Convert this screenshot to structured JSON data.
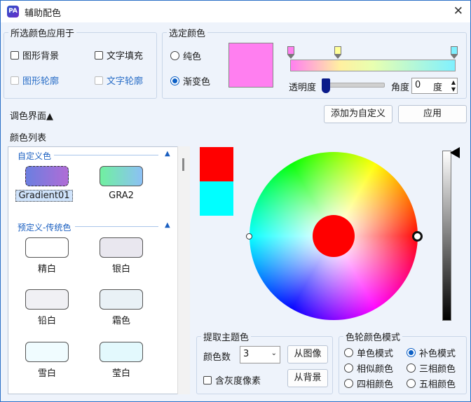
{
  "window": {
    "title": "辅助配色",
    "icon": "app-logo-icon",
    "close_label": "✕"
  },
  "apply_group": {
    "label": "所选颜色应用于",
    "items": [
      {
        "label": "图形背景",
        "checked": false,
        "enabled": true
      },
      {
        "label": "文字填充",
        "checked": false,
        "enabled": true
      },
      {
        "label": "图形轮廓",
        "checked": false,
        "enabled": false
      },
      {
        "label": "文字轮廓",
        "checked": false,
        "enabled": false
      }
    ]
  },
  "selected_color": {
    "label": "选定颜色",
    "solid_label": "纯色",
    "gradient_label": "渐变色",
    "mode": "gradient",
    "preview_color": "#ff7ff0",
    "gradient_stops": [
      {
        "color": "#ff80f0"
      },
      {
        "color": "#ffff99"
      },
      {
        "color": "#80f0ff"
      }
    ],
    "transparency_label": "透明度",
    "transparency": 0,
    "angle_label": "角度",
    "angle_value": "0",
    "angle_unit": "度"
  },
  "toolbar": {
    "palette_toggle": "调色界面▲",
    "add_custom": "添加为自定义",
    "apply": "应用"
  },
  "color_list": {
    "label": "颜色列表",
    "custom_section": "自定义色",
    "custom": [
      {
        "name": "Gradient01",
        "selected": true
      },
      {
        "name": "GRA2",
        "selected": false
      }
    ],
    "preset_section": "预定义-传统色",
    "preset": [
      {
        "name": "精白",
        "color": "#ffffff"
      },
      {
        "name": "银白",
        "color": "#e9e7ef"
      },
      {
        "name": "铅白",
        "color": "#f0f0f4"
      },
      {
        "name": "霜色",
        "color": "#e9f1f6"
      },
      {
        "name": "雪白",
        "color": "#f0fcff"
      },
      {
        "name": "莹白",
        "color": "#e3f9fd"
      }
    ]
  },
  "wheel": {
    "primary": "#ff0000",
    "complement": "#00ffff"
  },
  "extract": {
    "label": "提取主题色",
    "count_label": "颜色数",
    "count_value": "3",
    "from_image": "从图像",
    "gray_label": "含灰度像素",
    "from_background": "从背景"
  },
  "wheel_mode": {
    "label": "色轮颜色模式",
    "options": [
      "单色模式",
      "补色模式",
      "相似颜色",
      "三相颜色",
      "四相颜色",
      "五相颜色"
    ],
    "selected": "补色模式"
  }
}
